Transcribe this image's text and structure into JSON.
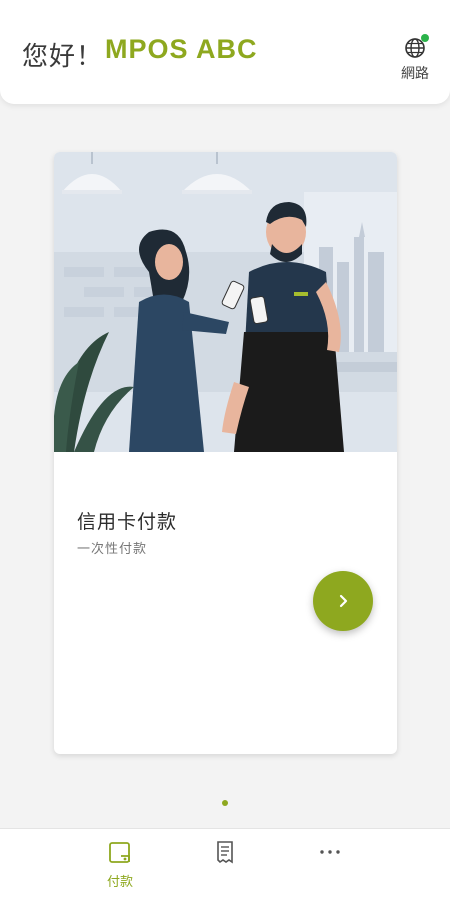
{
  "header": {
    "greeting": "您好！",
    "merchant_name": "MPOS ABC",
    "network_label": "網路",
    "network_status_color": "#2bb34a"
  },
  "payment_card": {
    "title": "信用卡付款",
    "subtitle": "一次性付款"
  },
  "pager": {
    "active_index": 0,
    "total": 1
  },
  "tabbar": {
    "tabs": [
      {
        "label": "付款",
        "icon": "wallet-icon",
        "active": true
      },
      {
        "label": "",
        "icon": "receipt-icon",
        "active": false
      },
      {
        "label": "",
        "icon": "more-icon",
        "active": false
      }
    ]
  },
  "colors": {
    "accent": "#8ea81f",
    "text": "#2c2c2c"
  }
}
